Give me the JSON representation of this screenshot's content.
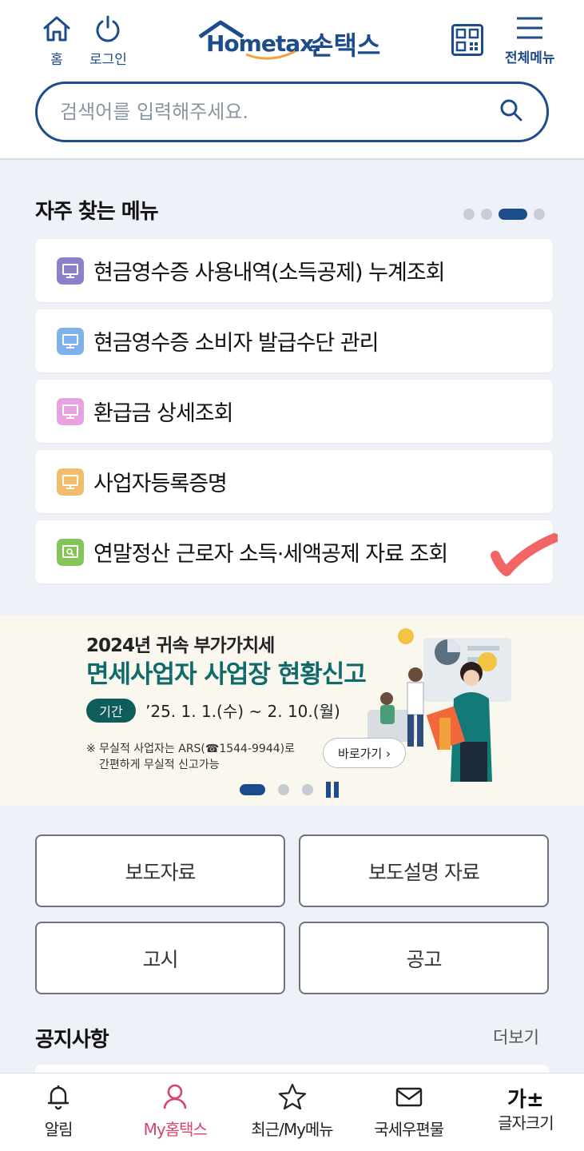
{
  "header": {
    "home_label": "홈",
    "login_label": "로그인",
    "logo_text": "Hometax.",
    "logo_korean": "손택스",
    "menu_label": "전체메뉴",
    "brand_color": "#1d4c8c"
  },
  "search": {
    "placeholder": "검색어를 입력해주세요."
  },
  "frequent": {
    "title": "자주 찾는 메뉴",
    "page_dots": 4,
    "active_dot": 3,
    "items": [
      {
        "label": "현금영수증 사용내역(소득공제) 누계조회",
        "icon_color": "#8e7fc9",
        "icon": "monitor-icon"
      },
      {
        "label": "현금영수증 소비자 발급수단 관리",
        "icon_color": "#7fb2ec",
        "icon": "monitor-icon"
      },
      {
        "label": "환급금 상세조회",
        "icon_color": "#e7a2e0",
        "icon": "monitor-icon"
      },
      {
        "label": "사업자등록증명",
        "icon_color": "#f1bd6c",
        "icon": "monitor-icon"
      },
      {
        "label": "연말정산 근로자 소득·세액공제 자료 조회",
        "icon_color": "#86c45a",
        "icon": "monitor-search-icon"
      }
    ]
  },
  "banner": {
    "year_line": "2024년 귀속 부가가치세",
    "title": "면세사업자 사업장 현황신고",
    "badge": "기간",
    "period": "’25. 1. 1.(수) ~ 2. 10.(월)",
    "note_line1": "※ 무실적 사업자는 ARS(☎1544-9944)로",
    "note_line2": "간편하게 무실적 신고가능",
    "go_label": "바로가기 ›",
    "slide_dots": 3,
    "active_slide": 1
  },
  "buttons": {
    "press": "보도자료",
    "press_explain": "보도설명 자료",
    "notice_official": "고시",
    "announcement": "공고"
  },
  "notices": {
    "title": "공지사항",
    "more": "더보기"
  },
  "tabbar": {
    "alarm": "알림",
    "my_hometax": "My홈택스",
    "recent": "최근/My메뉴",
    "mail": "국세우편물",
    "font_size": "글자크기",
    "font_size_glyph": "가±",
    "active_color": "#d6456a"
  }
}
